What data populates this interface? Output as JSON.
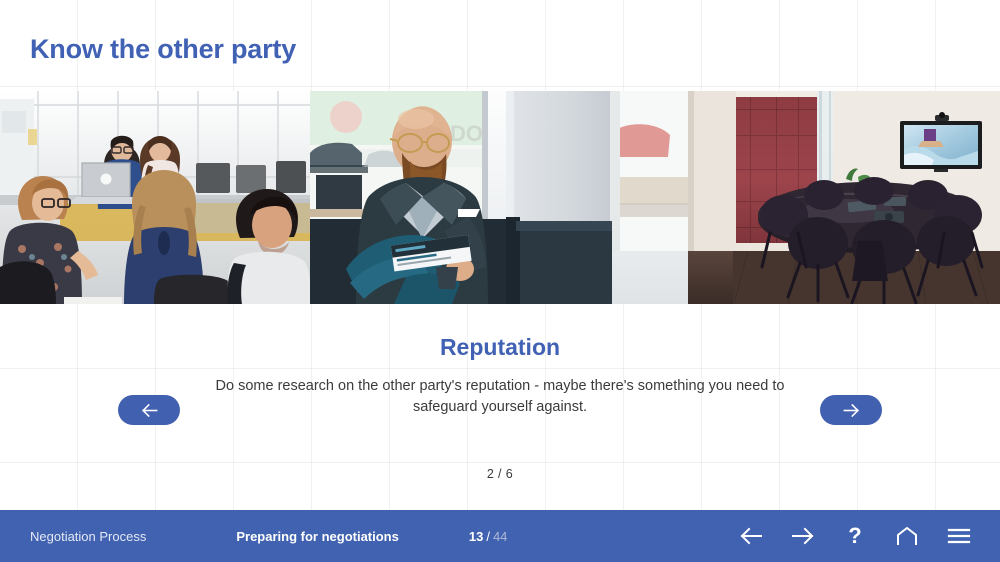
{
  "slide": {
    "title": "Know the other party"
  },
  "carousel": {
    "heading": "Reputation",
    "body": "Do some research on the other party's reputation - maybe there's something you need to safeguard yourself against.",
    "counter_current": "2",
    "counter_separator": "/",
    "counter_total": "6",
    "counter_text": "2 / 6",
    "prev_icon": "arrow-left-icon",
    "next_icon": "arrow-right-icon",
    "accent_color": "#4161B0"
  },
  "photos": [
    {
      "alt": "office-team-meeting-photo",
      "name": "photo-office-team"
    },
    {
      "alt": "bearded-man-with-magazine-photo",
      "name": "photo-man-reading"
    },
    {
      "alt": "empty-conference-room-photo",
      "name": "photo-conference-room"
    }
  ],
  "footer": {
    "course_name": "Negotiation Process",
    "lesson_name": "Preparing for negotiations",
    "page_current": "13",
    "page_separator": "/",
    "page_total": "44",
    "bar_color": "#4162B0",
    "actions": [
      {
        "name": "footer-back-button",
        "icon": "arrow-left-icon"
      },
      {
        "name": "footer-forward-button",
        "icon": "arrow-right-icon"
      },
      {
        "name": "footer-help-button",
        "icon": "question-mark-icon",
        "label": "?"
      },
      {
        "name": "footer-home-button",
        "icon": "home-icon"
      },
      {
        "name": "footer-menu-button",
        "icon": "hamburger-menu-icon"
      }
    ]
  },
  "theme": {
    "title_color": "#4161B4",
    "heading_color": "#4161B4",
    "body_text_color": "#3b3b3b",
    "background": "#ffffff",
    "grid_line_color": "rgba(0,0,0,0.055)"
  }
}
